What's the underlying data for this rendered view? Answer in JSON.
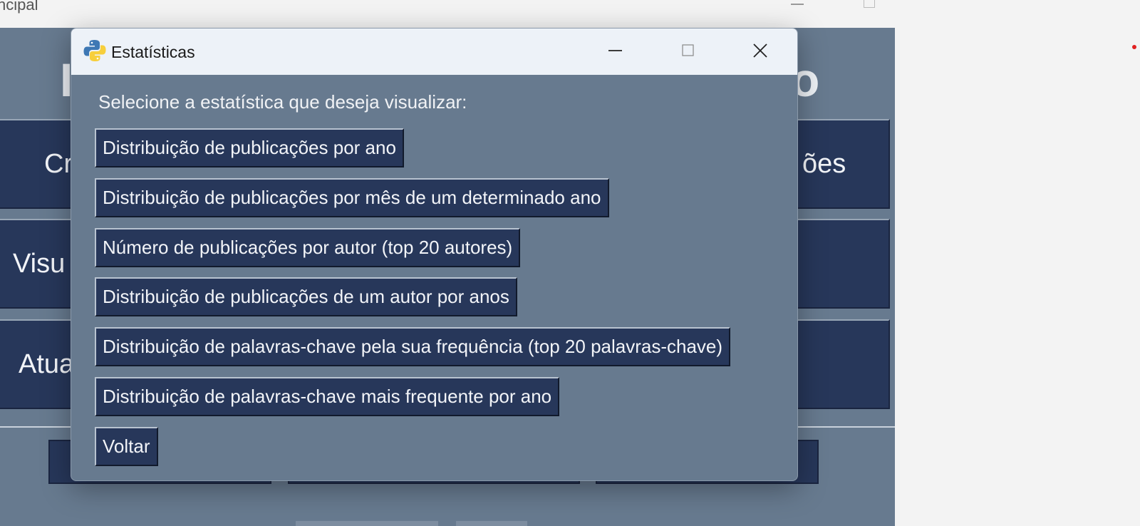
{
  "background_window": {
    "title": "ncipal",
    "heading_left": "I",
    "heading_right": "o",
    "buttons": [
      {
        "label": "Cr",
        "side": "left"
      },
      {
        "label": "ões",
        "side": "right"
      },
      {
        "label": "Visu",
        "side": "left"
      },
      {
        "label": "",
        "side": "right"
      },
      {
        "label": "Atua",
        "side": "left"
      },
      {
        "label": "",
        "side": "right"
      }
    ]
  },
  "dialog": {
    "title": "Estatísticas",
    "prompt": "Selecione a estatística que deseja visualizar:",
    "buttons": [
      {
        "label": "Distribuição de publicações por ano"
      },
      {
        "label": "Distribuição de publicações por mês de um determinado ano"
      },
      {
        "label": "Número de publicações por autor (top 20 autores)"
      },
      {
        "label": "Distribuição de publicações de um autor por anos"
      },
      {
        "label": "Distribuição de palavras-chave pela sua frequência (top 20 palavras-chave)"
      },
      {
        "label": "Distribuição de palavras-chave mais frequente por ano"
      },
      {
        "label": "Voltar"
      }
    ]
  },
  "icons": {
    "app": "python-logo-icon",
    "minimize": "minimize-icon",
    "maximize": "maximize-icon",
    "close": "close-icon"
  },
  "colors": {
    "dialog_bg": "#677a8f",
    "button_bg": "#27375a",
    "titlebar_bg": "#edf2f8"
  }
}
